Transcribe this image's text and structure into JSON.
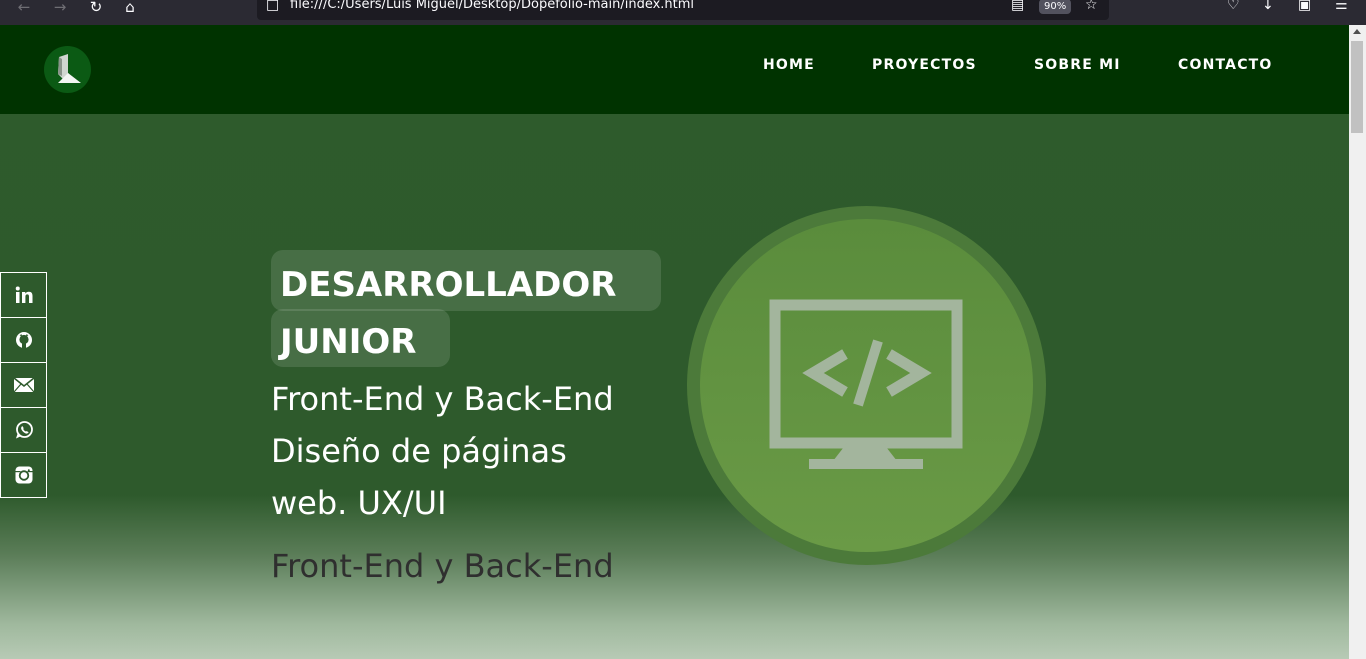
{
  "browser": {
    "url": "file:///C:/Users/Luis Miguel/Desktop/Dopefolio-main/index.html",
    "zoom": "90%"
  },
  "site": {
    "nav": [
      {
        "label": "HOME"
      },
      {
        "label": "PROYECTOS"
      },
      {
        "label": "SOBRE MI"
      },
      {
        "label": "CONTACTO"
      }
    ],
    "hero": {
      "title_line1": "DESARROLLADOR",
      "title_line2": "JUNIOR",
      "subtitle": "Front-End y Back-End Diseño de páginas web. UX/UI",
      "subtitle2": "Front-End y Back-End"
    },
    "social": [
      {
        "icon": "linkedin-icon"
      },
      {
        "icon": "github-icon"
      },
      {
        "icon": "email-icon"
      },
      {
        "icon": "whatsapp-icon"
      },
      {
        "icon": "instagram-icon"
      }
    ],
    "colors": {
      "header_bg": "#003300",
      "hero_bg": "#2e5a2c",
      "circle": "#5a8c3c",
      "monitor": "#a0b49a"
    }
  }
}
